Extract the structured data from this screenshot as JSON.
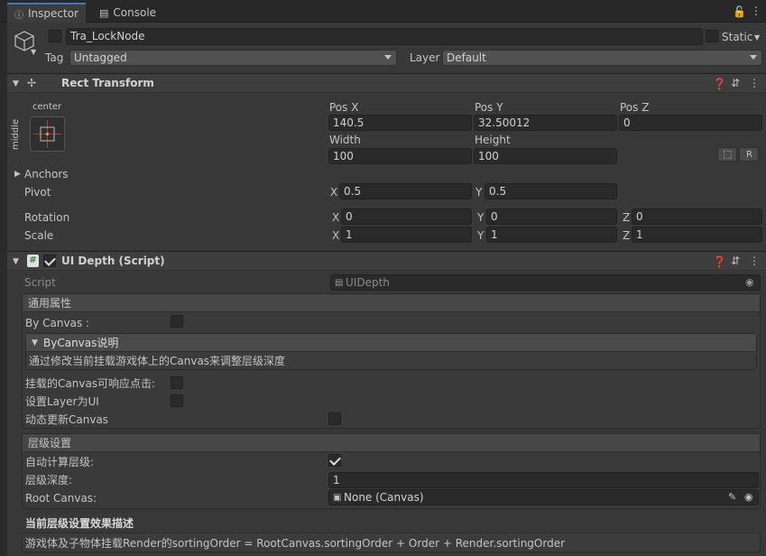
{
  "tabs": [
    {
      "label": "Inspector",
      "icon": "info-icon"
    },
    {
      "label": "Console",
      "icon": "console-icon"
    }
  ],
  "header": {
    "object_name": "Tra_LockNode",
    "static_label": "Static",
    "tag_label": "Tag",
    "tag_value": "Untagged",
    "layer_label": "Layer",
    "layer_value": "Default"
  },
  "rect_transform": {
    "title": "Rect Transform",
    "anchor_top_label": "center",
    "anchor_side_label": "middle",
    "pos_x_label": "Pos X",
    "pos_x": "140.5",
    "pos_y_label": "Pos Y",
    "pos_y": "32.50012",
    "pos_z_label": "Pos Z",
    "pos_z": "0",
    "width_label": "Width",
    "width": "100",
    "height_label": "Height",
    "height": "100",
    "r_button": "R",
    "anchors_label": "Anchors",
    "pivot_label": "Pivot",
    "pivot_x": "0.5",
    "pivot_y": "0.5",
    "rotation_label": "Rotation",
    "rot_x": "0",
    "rot_y": "0",
    "rot_z": "0",
    "scale_label": "Scale",
    "scale_x": "1",
    "scale_y": "1",
    "scale_z": "1",
    "x": "X",
    "y": "Y",
    "z": "Z"
  },
  "ui_depth": {
    "title": "UI Depth (Script)",
    "script_label": "Script",
    "script_value": "UIDepth",
    "general_section": "通用属性",
    "by_canvas_label": "By Canvas :",
    "by_canvas_checked": false,
    "bycanvas_note_title": "ByCanvas说明",
    "bycanvas_note_text": "通过修改当前挂载游戏体上的Canvas来调整层级深度",
    "canvas_clickable_label": "挂载的Canvas可响应点击:",
    "set_layer_ui_label": "设置Layer为UI",
    "dynamic_update_label": "动态更新Canvas",
    "level_section": "层级设置",
    "auto_calc_label": "自动计算层级:",
    "auto_calc_checked": true,
    "depth_label": "层级深度:",
    "depth_value": "1",
    "root_canvas_label": "Root Canvas:",
    "root_canvas_value": "None (Canvas)",
    "effect_title": "当前层级设置效果描述",
    "effect_text": "游戏体及子物体挂载Render的sortingOrder  = RootCanvas.sortingOrder + Order + Render.sortingOrder"
  }
}
